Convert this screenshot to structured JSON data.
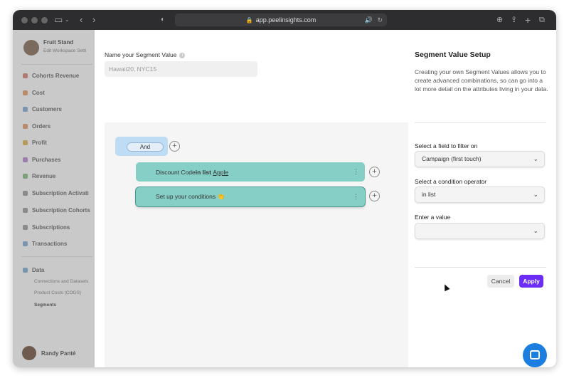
{
  "browser": {
    "url": "app.peelinsights.com"
  },
  "sidebar": {
    "workspace_name": "Fruit Stand",
    "workspace_sub": "Edit Workspace Setti",
    "items": [
      {
        "label": "Cohorts Revenue",
        "color": "#b07a70"
      },
      {
        "label": "Cost",
        "color": "#b88c6a"
      },
      {
        "label": "Customers",
        "color": "#7a95b0"
      },
      {
        "label": "Orders",
        "color": "#b88c6a"
      },
      {
        "label": "Profit",
        "color": "#b89a5c"
      },
      {
        "label": "Purchases",
        "color": "#9c7db0"
      },
      {
        "label": "Revenue",
        "color": "#7ca07a"
      },
      {
        "label": "Subscription Activati",
        "color": "#8a8a8a"
      },
      {
        "label": "Subscription Cohorts",
        "color": "#8a8a8a"
      },
      {
        "label": "Subscriptions",
        "color": "#8a8a8a"
      },
      {
        "label": "Transactions",
        "color": "#7a95b0"
      }
    ],
    "data_section": {
      "label": "Data",
      "sub_items": [
        "Connections and Datasets",
        "Product Costs (COGS)",
        "Segments"
      ]
    },
    "user_name": "Randy Panté"
  },
  "modal": {
    "name_label": "Name your Segment Value",
    "name_placeholder": "Hawaii20, NYC15",
    "builder": {
      "group_operator": "And",
      "conditions": [
        {
          "prefix": "Discount Code ",
          "operator": "in list",
          "value": "Apple"
        },
        {
          "text": "Set up your conditions 👏"
        }
      ]
    },
    "setup_title": "Segment Value Setup",
    "setup_description": "Creating your own Segment Values allows you to create advanced combinations, so can go into a lot more detail on the attributes living in your data.",
    "field_label": "Select a field to filter on",
    "field_value": "Campaign (first touch)",
    "operator_label": "Select a condition operator",
    "operator_value": "in list",
    "value_label": "Enter a value",
    "value_value": "",
    "cancel_label": "Cancel",
    "apply_label": "Apply"
  },
  "colors": {
    "accent": "#6b2cf5",
    "condition_bg": "#86cfc7",
    "group_bg": "#bfdcf5",
    "chat_button": "#1c7fe0"
  }
}
